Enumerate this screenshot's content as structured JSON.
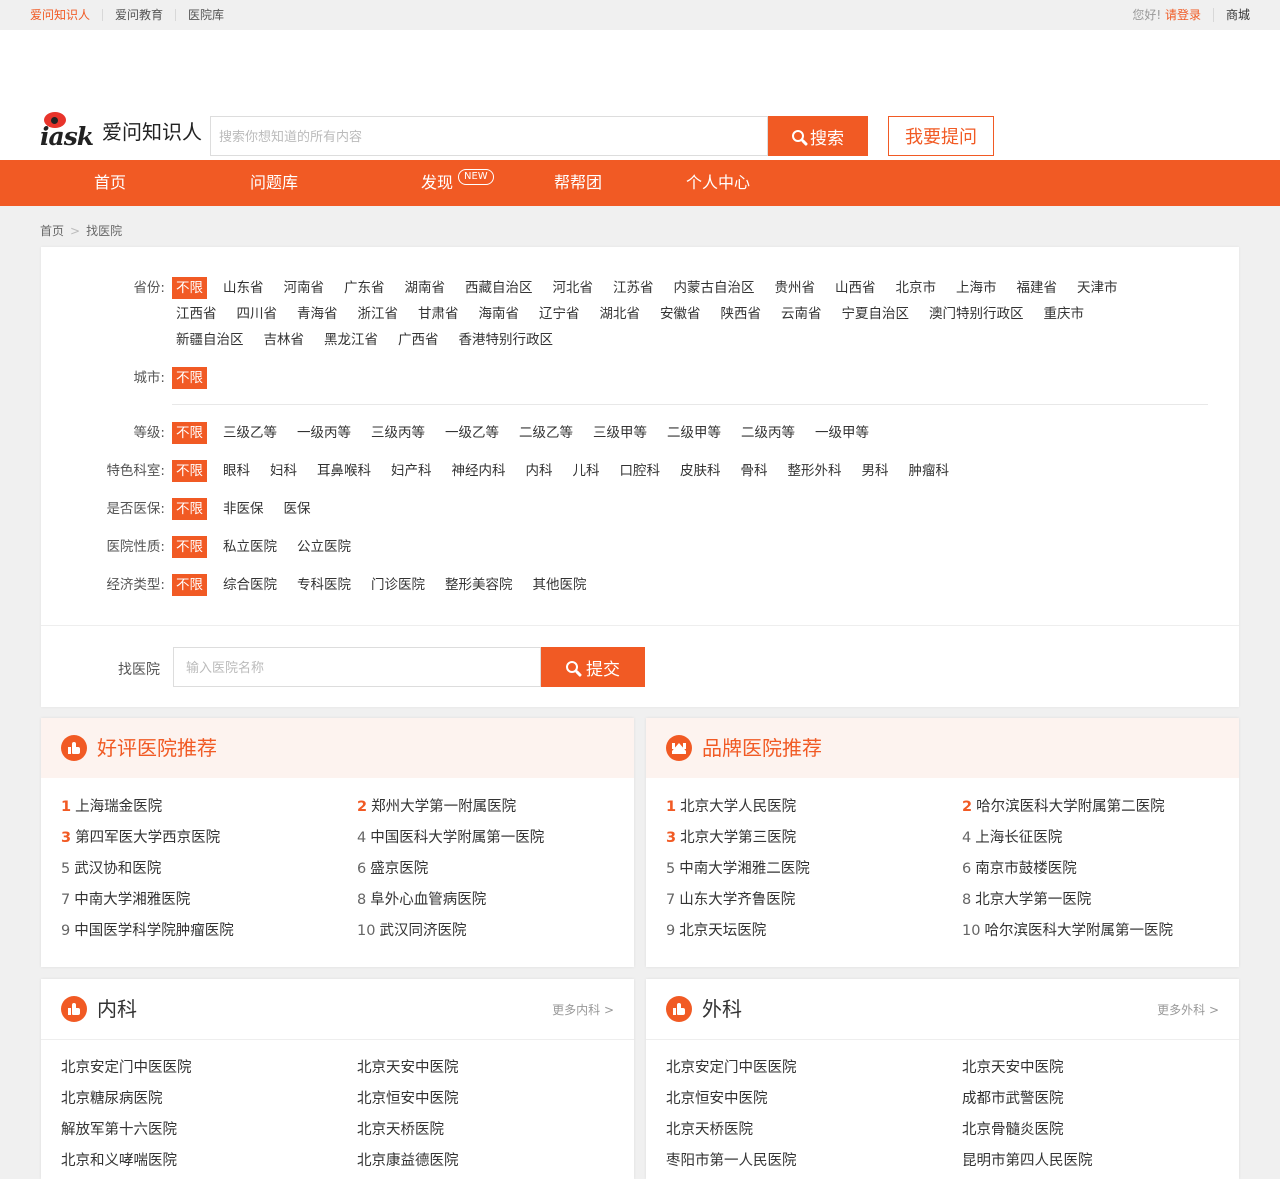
{
  "topbar": {
    "links": [
      "爱问知识人",
      "爱问教育",
      "医院库"
    ],
    "greeting": "您好!",
    "login": "请登录",
    "mall": "商城"
  },
  "header": {
    "logo_mark": "iask",
    "logo_name": "爱问知识人",
    "search_placeholder": "搜索你想知道的所有内容",
    "search_button": "搜索",
    "ask_button": "我要提问"
  },
  "nav": {
    "items": [
      "首页",
      "问题库",
      "发现",
      "帮帮团",
      "个人中心"
    ],
    "new_badge": "NEW"
  },
  "breadcrumb": [
    "首页",
    "找医院"
  ],
  "filters": {
    "province": {
      "label": "省份:",
      "options": [
        "不限",
        "山东省",
        "河南省",
        "广东省",
        "湖南省",
        "西藏自治区",
        "河北省",
        "江苏省",
        "内蒙古自治区",
        "贵州省",
        "山西省",
        "北京市",
        "上海市",
        "福建省",
        "天津市",
        "江西省",
        "四川省",
        "青海省",
        "浙江省",
        "甘肃省",
        "海南省",
        "辽宁省",
        "湖北省",
        "安徽省",
        "陕西省",
        "云南省",
        "宁夏自治区",
        "澳门特别行政区",
        "重庆市",
        "新疆自治区",
        "吉林省",
        "黑龙江省",
        "广西省",
        "香港特别行政区"
      ]
    },
    "city": {
      "label": "城市:",
      "options": [
        "不限"
      ]
    },
    "level": {
      "label": "等级:",
      "options": [
        "不限",
        "三级乙等",
        "一级丙等",
        "三级丙等",
        "一级乙等",
        "二级乙等",
        "三级甲等",
        "二级甲等",
        "二级丙等",
        "一级甲等"
      ]
    },
    "dept": {
      "label": "特色科室:",
      "options": [
        "不限",
        "眼科",
        "妇科",
        "耳鼻喉科",
        "妇产科",
        "神经内科",
        "内科",
        "儿科",
        "口腔科",
        "皮肤科",
        "骨科",
        "整形外科",
        "男科",
        "肿瘤科"
      ]
    },
    "insurance": {
      "label": "是否医保:",
      "options": [
        "不限",
        "非医保",
        "医保"
      ]
    },
    "nature": {
      "label": "医院性质:",
      "options": [
        "不限",
        "私立医院",
        "公立医院"
      ]
    },
    "economy": {
      "label": "经济类型:",
      "options": [
        "不限",
        "综合医院",
        "专科医院",
        "门诊医院",
        "整形美容院",
        "其他医院"
      ]
    }
  },
  "finder": {
    "label": "找医院",
    "placeholder": "输入医院名称",
    "button": "提交"
  },
  "cards": {
    "good": {
      "title": "好评医院推荐",
      "icon": "thumbs-up-icon",
      "items": [
        "上海瑞金医院",
        "郑州大学第一附属医院",
        "第四军医大学西京医院",
        "中国医科大学附属第一医院",
        "武汉协和医院",
        "盛京医院",
        "中南大学湘雅医院",
        "阜外心血管病医院",
        "中国医学科学院肿瘤医院",
        "武汉同济医院"
      ]
    },
    "brand": {
      "title": "品牌医院推荐",
      "icon": "crown-icon",
      "items": [
        "北京大学人民医院",
        "哈尔滨医科大学附属第二医院",
        "北京大学第三医院",
        "上海长征医院",
        "中南大学湘雅二医院",
        "南京市鼓楼医院",
        "山东大学齐鲁医院",
        "北京大学第一医院",
        "北京天坛医院",
        "哈尔滨医科大学附属第一医院"
      ]
    },
    "internal": {
      "title": "内科",
      "more": "更多内科",
      "items": [
        "北京安定门中医医院",
        "北京天安中医院",
        "北京糖尿病医院",
        "北京恒安中医院",
        "解放军第十六医院",
        "北京天桥医院",
        "北京和义哮喘医院",
        "北京康益德医院"
      ]
    },
    "surgery": {
      "title": "外科",
      "more": "更多外科",
      "items": [
        "北京安定门中医医院",
        "北京天安中医院",
        "北京恒安中医院",
        "成都市武警医院",
        "北京天桥医院",
        "北京骨髓炎医院",
        "枣阳市第一人民医院",
        "昆明市第四人民医院"
      ]
    }
  },
  "colors": {
    "accent": "#f15a24"
  }
}
